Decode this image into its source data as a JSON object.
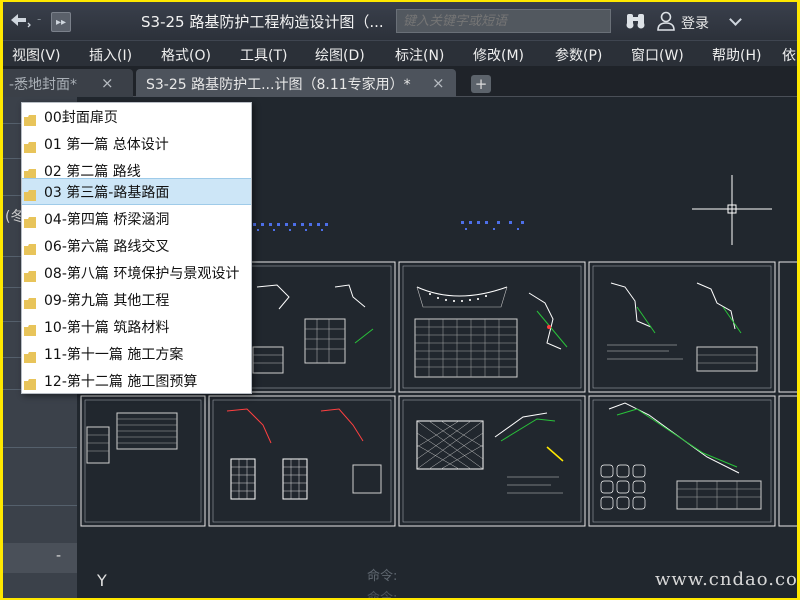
{
  "titlebar": {
    "document_title": "S3-25 路基防护工程构造设计图（...",
    "search_placeholder": "键入关键字或短语",
    "login_label": "登录"
  },
  "menubar": {
    "items": [
      "视图(V)",
      "插入(I)",
      "格式(O)",
      "工具(T)",
      "绘图(D)",
      "标注(N)",
      "修改(M)",
      "参数(P)",
      "窗口(W)",
      "帮助(H)",
      "依"
    ]
  },
  "tabs": [
    {
      "label": "-悉地封面*",
      "close": "×"
    },
    {
      "label": "S3-25 路基防护工...计图（8.11专家用）*",
      "close": "×"
    }
  ],
  "new_tab_label": "+",
  "side_panel": {
    "glyph": "(冬",
    "collapse_label": "-"
  },
  "folder_dropdown": {
    "selected_index": 3,
    "items": [
      {
        "label": "00封面扉页"
      },
      {
        "label": "01 第一篇 总体设计"
      },
      {
        "label": "02 第二篇 路线"
      },
      {
        "label": "03 第三篇-路基路面"
      },
      {
        "label": "04-第四篇 桥梁涵洞"
      },
      {
        "label": "06-第六篇 路线交叉"
      },
      {
        "label": "08-第八篇 环境保护与景观设计"
      },
      {
        "label": "09-第九篇 其他工程"
      },
      {
        "label": "10-第十篇 筑路材料"
      },
      {
        "label": "11-第十一篇 施工方案"
      },
      {
        "label": "12-第十二篇 施工图预算"
      }
    ]
  },
  "canvas": {
    "y_axis_label": "Y",
    "command_prompt": "命令:",
    "command_prompt_2": "命令:",
    "watermark": "www.cndao.com"
  },
  "colors": {
    "screen_border": "#ffe800",
    "canvas_bg": "#21272e",
    "selection_bg": "#cde6f7",
    "folder_yellow": "#e8c45a"
  }
}
